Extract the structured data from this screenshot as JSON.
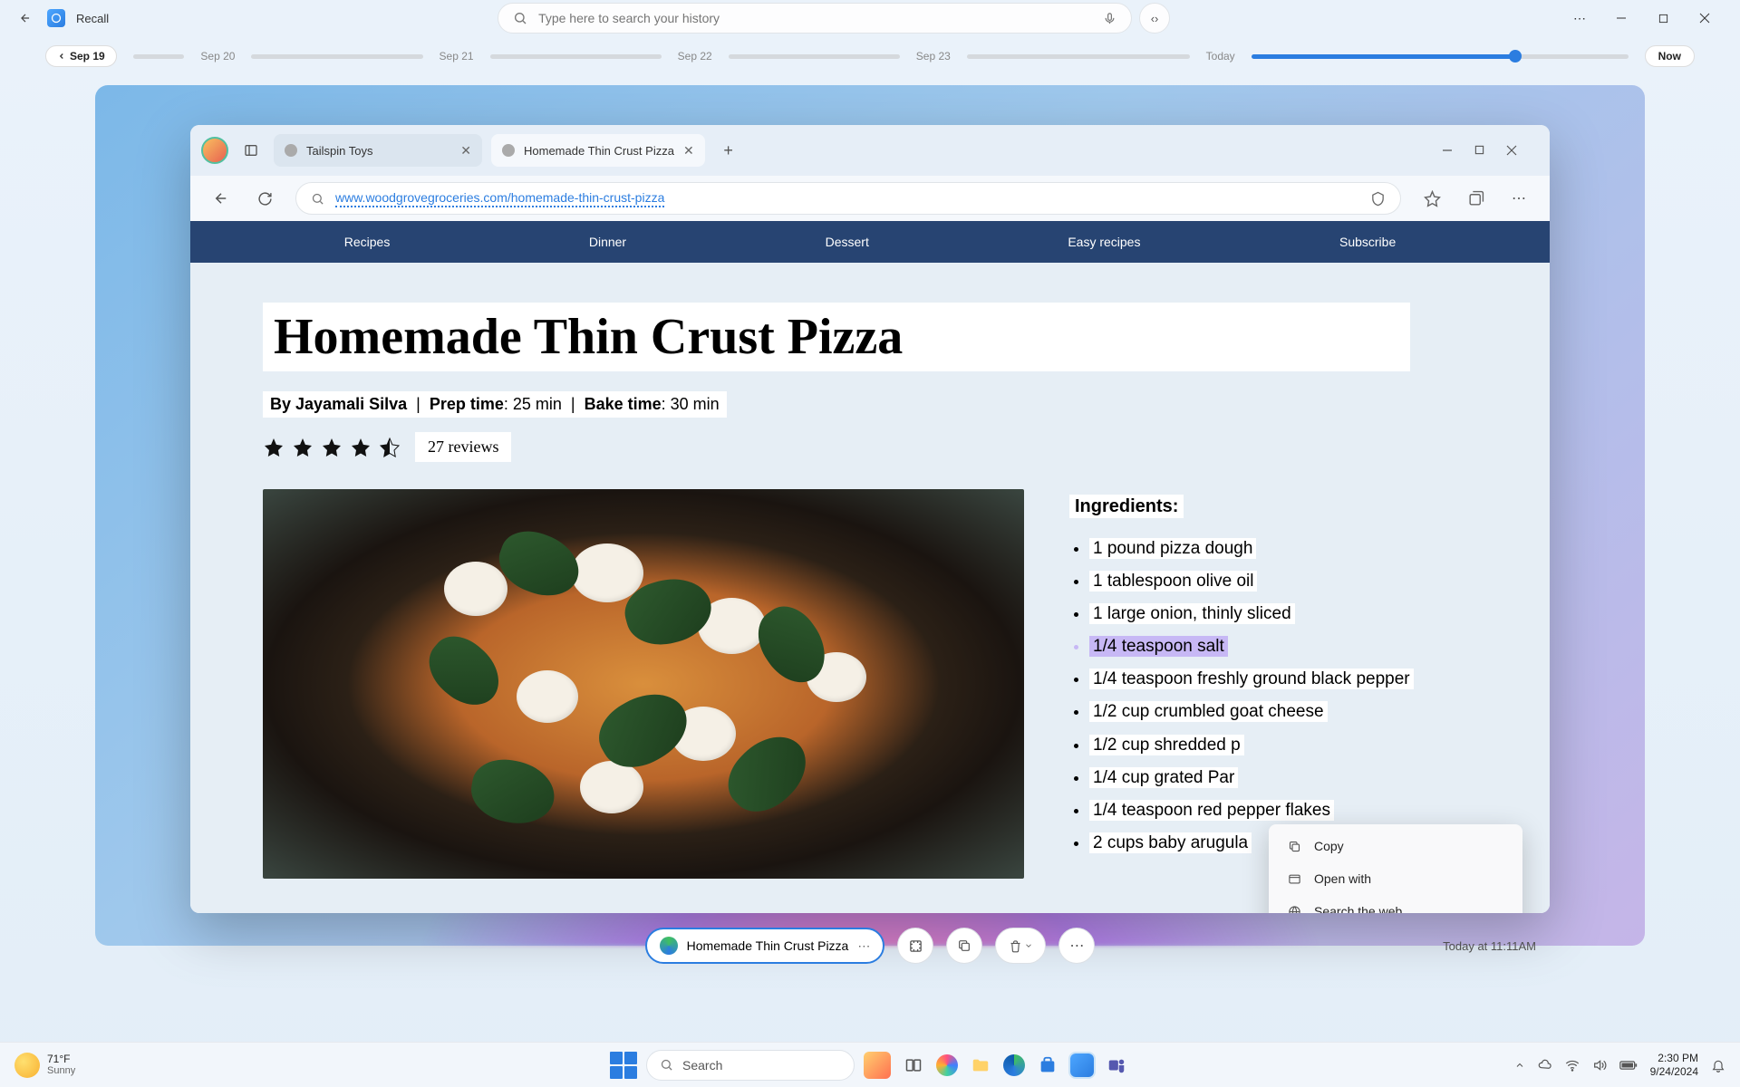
{
  "app": {
    "name": "Recall"
  },
  "search": {
    "placeholder": "Type here to search your history"
  },
  "timeline": {
    "current": "Sep 19",
    "dates": [
      "Sep 20",
      "Sep 21",
      "Sep 22",
      "Sep 23"
    ],
    "today": "Today",
    "now": "Now"
  },
  "browser": {
    "tabs": [
      {
        "title": "Tailspin Toys"
      },
      {
        "title": "Homemade Thin Crust Pizza"
      }
    ],
    "url": "www.woodgrovegroceries.com/homemade-thin-crust-pizza",
    "nav": [
      "Recipes",
      "Dinner",
      "Dessert",
      "Easy recipes",
      "Subscribe"
    ]
  },
  "recipe": {
    "title": "Homemade Thin Crust Pizza",
    "author_prefix": "By",
    "author": "Jayamali Silva",
    "prep_label": "Prep time",
    "prep_value": "25 min",
    "bake_label": "Bake time",
    "bake_value": "30 min",
    "reviews": "27 reviews",
    "ingredients_heading": "Ingredients:",
    "ingredients": [
      "1 pound pizza dough",
      "1 tablespoon olive oil",
      "1 large onion, thinly sliced",
      "1/4 teaspoon salt",
      "1/4 teaspoon freshly ground black pepper",
      "1/2 cup crumbled goat cheese",
      "1/2 cup shredded p",
      "1/4 cup grated Par",
      "1/4 teaspoon red pepper flakes",
      "2 cups baby arugula"
    ]
  },
  "context_menu": {
    "copy": "Copy",
    "open_with": "Open with",
    "search_web": "Search the web"
  },
  "bottom": {
    "source_title": "Homemade Thin Crust Pizza",
    "timestamp": "Today at 11:11AM"
  },
  "taskbar": {
    "temp": "71°F",
    "cond": "Sunny",
    "search": "Search",
    "time": "2:30 PM",
    "date": "9/24/2024"
  }
}
